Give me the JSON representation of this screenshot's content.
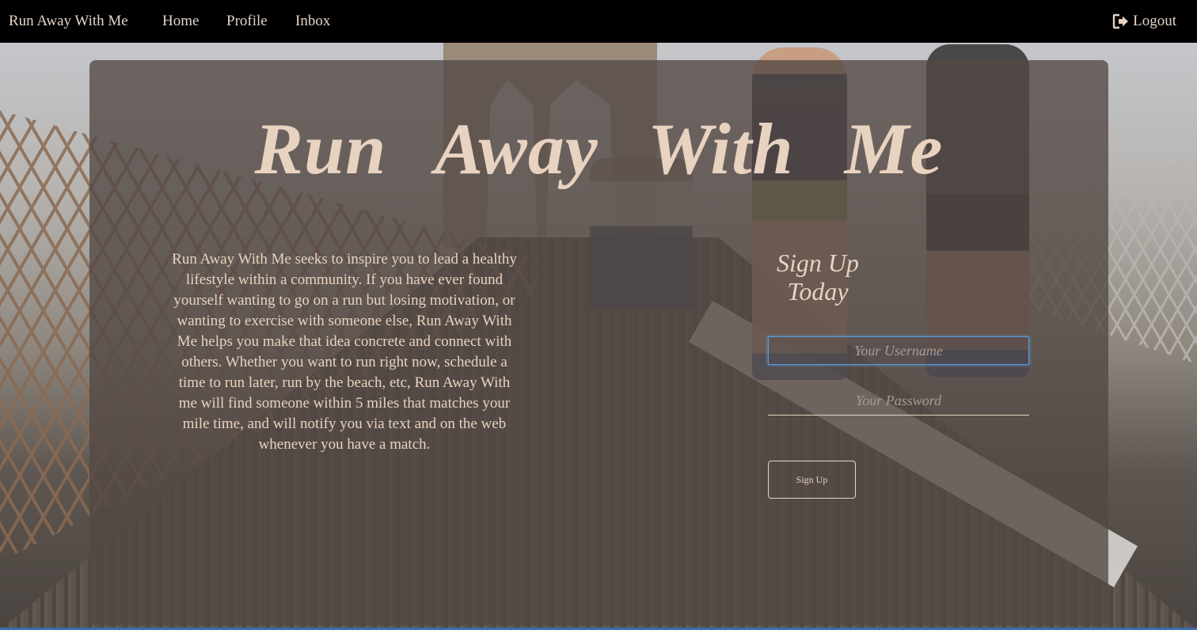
{
  "navbar": {
    "brand": "Run Away With Me",
    "links": [
      "Home",
      "Profile",
      "Inbox"
    ],
    "logout_label": "Logout",
    "logout_icon": "sign-out-icon"
  },
  "hero": {
    "title": "Run Away  With Me"
  },
  "intro": {
    "text": "Run Away With Me seeks to inspire you to lead a healthy lifestyle within a community. If you have ever found yourself wanting to go on a run but losing motivation, or wanting to exercise with someone else, Run Away With Me helps you make that idea concrete and connect with others. Whether you want to run right now, schedule a time to run later, run by the beach, etc, Run Away With me will find someone within 5 miles that matches your mile time, and will notify you via text and on the web whenever you have a match."
  },
  "signup": {
    "heading": "Sign Up Today",
    "username_placeholder": "Your Username",
    "username_value": "",
    "password_placeholder": "Your Password",
    "password_value": "",
    "button_label": "Sign Up"
  },
  "colors": {
    "navbar_bg": "#000000",
    "text": "#e8d2c0",
    "focus": "#5b9bd5"
  }
}
